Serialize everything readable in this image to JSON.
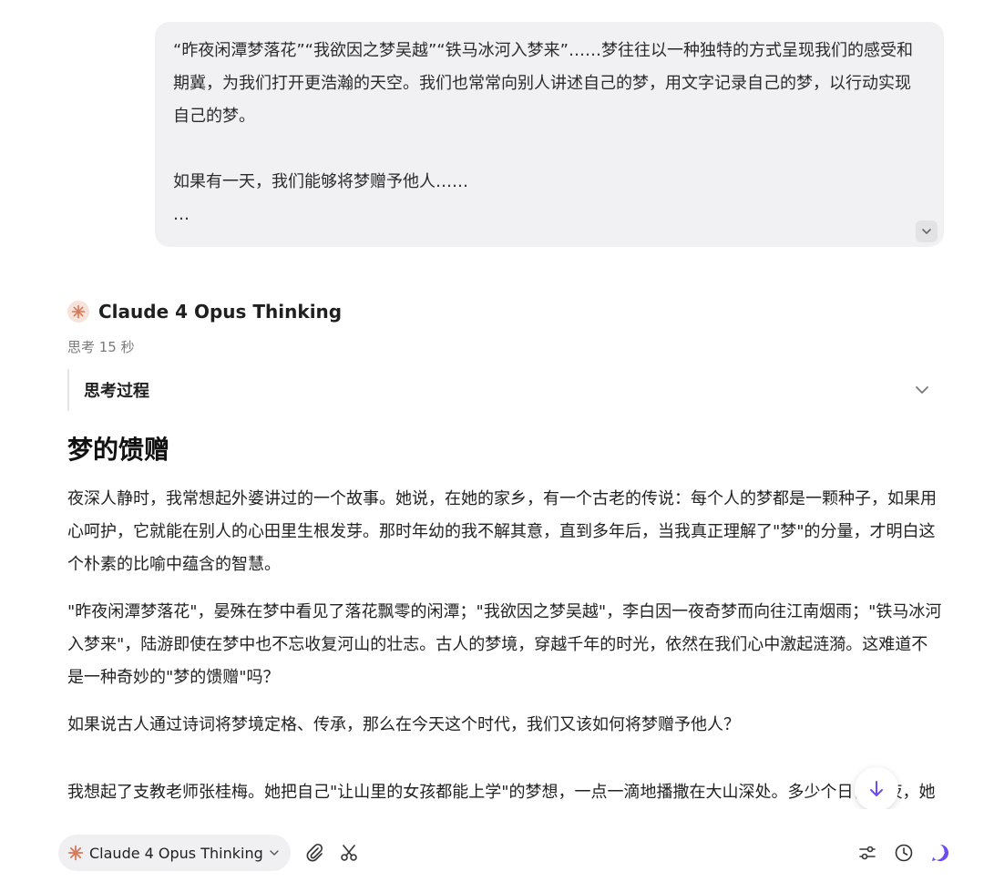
{
  "user_message": {
    "para1": "“昨夜闲潭梦落花”“我欲因之梦吴越”“铁马冰河入梦来”……梦往往以一种独特的方式呈现我们的感受和期冀，为我们打开更浩瀚的天空。我们也常常向别人讲述自己的梦，用文字记录自己的梦，以行动实现自己的梦。",
    "para2": "如果有一天，我们能够将梦赠予他人……",
    "para3": "…"
  },
  "response": {
    "model_name": "Claude 4 Opus Thinking",
    "think_time": "思考 15 秒",
    "think_title": "思考过程",
    "title": "梦的馈赠",
    "paragraphs": [
      "夜深人静时，我常想起外婆讲过的一个故事。她说，在她的家乡，有一个古老的传说：每个人的梦都是一颗种子，如果用心呵护，它就能在别人的心田里生根发芽。那时年幼的我不解其意，直到多年后，当我真正理解了\"梦\"的分量，才明白这个朴素的比喻中蕴含的智慧。",
      "\"昨夜闲潭梦落花\"，晏殊在梦中看见了落花飘零的闲潭；\"我欲因之梦吴越\"，李白因一夜奇梦而向往江南烟雨；\"铁马冰河入梦来\"，陆游即使在梦中也不忘收复河山的壮志。古人的梦境，穿越千年的时光，依然在我们心中激起涟漪。这难道不是一种奇妙的\"梦的馈赠\"吗？",
      "如果说古人通过诗词将梦境定格、传承，那么在今天这个时代，我们又该如何将梦赠予他人？"
    ],
    "partial_paragraph": "我想起了支教老师张桂梅。她把自己\"让山里的女孩都能上学\"的梦想，一点一滴地播撒在大山深处。多少个日日夜夜，她用瘦弱的肩膀扛起孩子们的未来。当第一批女孩考上大学时，当她们成为医生、教师、工程师"
  },
  "toolbar": {
    "model_label": "Claude 4 Opus Thinking"
  },
  "colors": {
    "accent": "#6b4cf0",
    "claude_orange": "#d97757",
    "bubble_bg": "#f1f1f3"
  },
  "icons": [
    "chevron-down-icon",
    "claude-logo-icon",
    "paperclip-icon",
    "scissors-icon",
    "sliders-icon",
    "clock-icon",
    "new-chat-icon",
    "arrow-down-icon"
  ]
}
